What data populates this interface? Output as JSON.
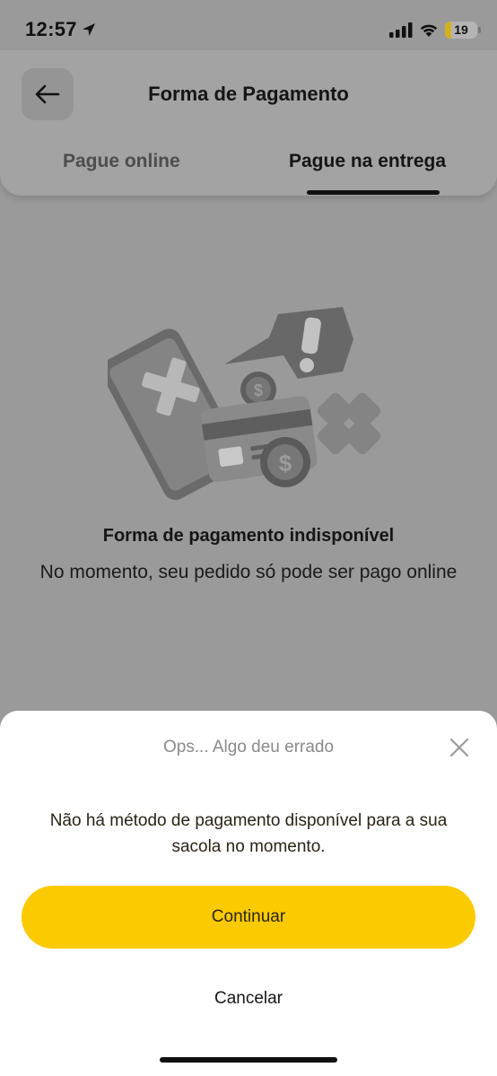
{
  "status_bar": {
    "time": "12:57",
    "battery_level": "19",
    "battery_fraction": 0.19,
    "icons": [
      "location-arrow-icon",
      "signal-icon",
      "wifi-icon",
      "battery-charging-icon"
    ]
  },
  "header": {
    "title": "Forma de Pagamento",
    "back_icon": "arrow-left-icon",
    "tabs": [
      {
        "label": "Pague online",
        "active": false
      },
      {
        "label": "Pague na entrega",
        "active": true
      }
    ]
  },
  "empty_state": {
    "illustration_icon": "payment-unavailable-illustration",
    "title": "Forma de pagamento indisponível",
    "description": "No momento, seu pedido só pode ser pago online"
  },
  "sheet": {
    "title": "Ops... Algo deu errado",
    "close_icon": "close-icon",
    "message": "Não há método de pagamento disponível para a sua sacola no momento.",
    "continue_label": "Continuar",
    "cancel_label": "Cancelar"
  },
  "colors": {
    "accent": "#fcca00",
    "overlay_background": "#9a9a9a",
    "sheet_background": "#ffffff"
  }
}
